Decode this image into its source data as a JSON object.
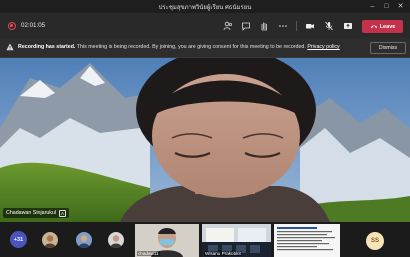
{
  "window": {
    "title": "ประชุมสุขภาพวินัยผู้เรียน ศธนัมรยน"
  },
  "toolbar": {
    "timer": "02:01:05",
    "leave_label": "Leave"
  },
  "banner": {
    "bold": "Recording has started.",
    "text": " This meeting is being recorded. By joining, you are giving consent for this meeting to be recorded. ",
    "link": "Privacy policy",
    "dismiss_label": "Dismiss"
  },
  "stage": {
    "speaker_name": "Chadawan Sinjarukul",
    "speaker_badge": "A"
  },
  "strip": {
    "more_count": "+31",
    "thumbs": [
      {
        "label": "chadaw11"
      },
      {
        "label": "Wisanu Prakobkit"
      },
      {
        "label": ""
      }
    ],
    "ss_initials": "SS"
  },
  "colors": {
    "leave": "#c4314b",
    "accent": "#4b53bc",
    "recording": "#e04b54"
  },
  "icons": [
    "info-icon",
    "participants-icon",
    "chat-icon",
    "raise-hand-icon",
    "more-icon",
    "camera-icon",
    "mic-off-icon",
    "share-icon",
    "phone-icon"
  ]
}
